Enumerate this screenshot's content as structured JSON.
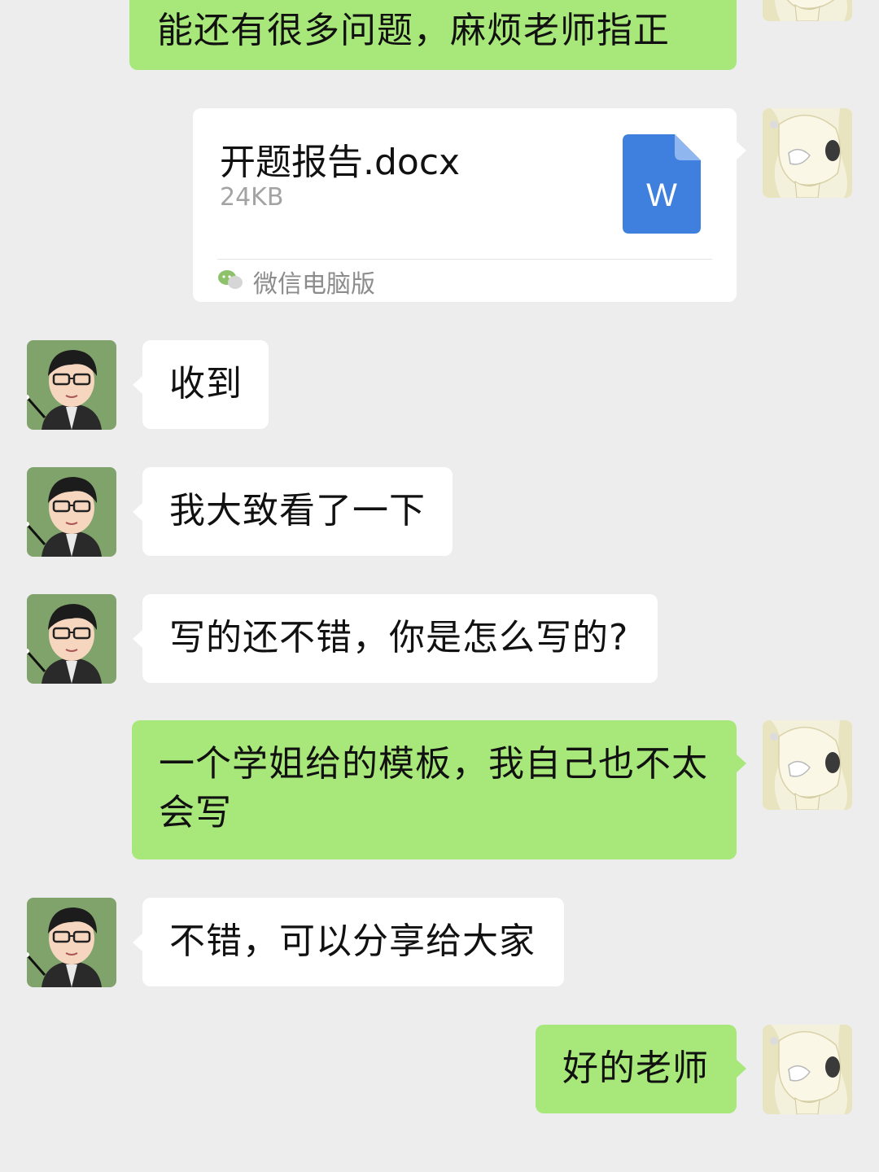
{
  "chat": {
    "messages": [
      {
        "side": "right",
        "type": "text",
        "text": "能还有很多问题，麻烦老师指正"
      },
      {
        "side": "right",
        "type": "file",
        "file_name": "开题报告.docx",
        "file_size": "24KB",
        "file_icon_letter": "W",
        "source": "微信电脑版",
        "source_icon": "wechat-icon"
      },
      {
        "side": "left",
        "type": "text",
        "text": "收到"
      },
      {
        "side": "left",
        "type": "text",
        "text": "我大致看了一下"
      },
      {
        "side": "left",
        "type": "text",
        "text": "写的还不错，你是怎么写的?"
      },
      {
        "side": "right",
        "type": "text",
        "text_line1": "一个学姐给的模板，我自己也不太",
        "text_line2": "会写"
      },
      {
        "side": "left",
        "type": "text",
        "text": "不错，可以分享给大家"
      },
      {
        "side": "right",
        "type": "text",
        "text": "好的老师"
      }
    ]
  },
  "colors": {
    "background": "#ededed",
    "sent_bubble": "#a8e87a",
    "received_bubble": "#ffffff",
    "word_icon": "#3f7fdd"
  },
  "icons": {
    "teacher_avatar": "teacher-avatar-icon",
    "student_avatar": "student-avatar-icon",
    "word_file": "word-file-icon",
    "wechat": "wechat-icon"
  }
}
